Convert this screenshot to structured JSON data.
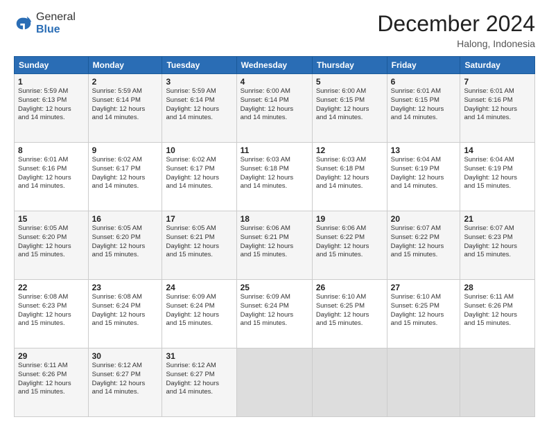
{
  "header": {
    "logo_general": "General",
    "logo_blue": "Blue",
    "month_title": "December 2024",
    "location": "Halong, Indonesia"
  },
  "weekdays": [
    "Sunday",
    "Monday",
    "Tuesday",
    "Wednesday",
    "Thursday",
    "Friday",
    "Saturday"
  ],
  "weeks": [
    [
      {
        "day": "1",
        "sunrise": "5:59 AM",
        "sunset": "6:13 PM",
        "daylight": "12 hours and 14 minutes."
      },
      {
        "day": "2",
        "sunrise": "5:59 AM",
        "sunset": "6:14 PM",
        "daylight": "12 hours and 14 minutes."
      },
      {
        "day": "3",
        "sunrise": "5:59 AM",
        "sunset": "6:14 PM",
        "daylight": "12 hours and 14 minutes."
      },
      {
        "day": "4",
        "sunrise": "6:00 AM",
        "sunset": "6:14 PM",
        "daylight": "12 hours and 14 minutes."
      },
      {
        "day": "5",
        "sunrise": "6:00 AM",
        "sunset": "6:15 PM",
        "daylight": "12 hours and 14 minutes."
      },
      {
        "day": "6",
        "sunrise": "6:01 AM",
        "sunset": "6:15 PM",
        "daylight": "12 hours and 14 minutes."
      },
      {
        "day": "7",
        "sunrise": "6:01 AM",
        "sunset": "6:16 PM",
        "daylight": "12 hours and 14 minutes."
      }
    ],
    [
      {
        "day": "8",
        "sunrise": "6:01 AM",
        "sunset": "6:16 PM",
        "daylight": "12 hours and 14 minutes."
      },
      {
        "day": "9",
        "sunrise": "6:02 AM",
        "sunset": "6:17 PM",
        "daylight": "12 hours and 14 minutes."
      },
      {
        "day": "10",
        "sunrise": "6:02 AM",
        "sunset": "6:17 PM",
        "daylight": "12 hours and 14 minutes."
      },
      {
        "day": "11",
        "sunrise": "6:03 AM",
        "sunset": "6:18 PM",
        "daylight": "12 hours and 14 minutes."
      },
      {
        "day": "12",
        "sunrise": "6:03 AM",
        "sunset": "6:18 PM",
        "daylight": "12 hours and 14 minutes."
      },
      {
        "day": "13",
        "sunrise": "6:04 AM",
        "sunset": "6:19 PM",
        "daylight": "12 hours and 14 minutes."
      },
      {
        "day": "14",
        "sunrise": "6:04 AM",
        "sunset": "6:19 PM",
        "daylight": "12 hours and 15 minutes."
      }
    ],
    [
      {
        "day": "15",
        "sunrise": "6:05 AM",
        "sunset": "6:20 PM",
        "daylight": "12 hours and 15 minutes."
      },
      {
        "day": "16",
        "sunrise": "6:05 AM",
        "sunset": "6:20 PM",
        "daylight": "12 hours and 15 minutes."
      },
      {
        "day": "17",
        "sunrise": "6:05 AM",
        "sunset": "6:21 PM",
        "daylight": "12 hours and 15 minutes."
      },
      {
        "day": "18",
        "sunrise": "6:06 AM",
        "sunset": "6:21 PM",
        "daylight": "12 hours and 15 minutes."
      },
      {
        "day": "19",
        "sunrise": "6:06 AM",
        "sunset": "6:22 PM",
        "daylight": "12 hours and 15 minutes."
      },
      {
        "day": "20",
        "sunrise": "6:07 AM",
        "sunset": "6:22 PM",
        "daylight": "12 hours and 15 minutes."
      },
      {
        "day": "21",
        "sunrise": "6:07 AM",
        "sunset": "6:23 PM",
        "daylight": "12 hours and 15 minutes."
      }
    ],
    [
      {
        "day": "22",
        "sunrise": "6:08 AM",
        "sunset": "6:23 PM",
        "daylight": "12 hours and 15 minutes."
      },
      {
        "day": "23",
        "sunrise": "6:08 AM",
        "sunset": "6:24 PM",
        "daylight": "12 hours and 15 minutes."
      },
      {
        "day": "24",
        "sunrise": "6:09 AM",
        "sunset": "6:24 PM",
        "daylight": "12 hours and 15 minutes."
      },
      {
        "day": "25",
        "sunrise": "6:09 AM",
        "sunset": "6:24 PM",
        "daylight": "12 hours and 15 minutes."
      },
      {
        "day": "26",
        "sunrise": "6:10 AM",
        "sunset": "6:25 PM",
        "daylight": "12 hours and 15 minutes."
      },
      {
        "day": "27",
        "sunrise": "6:10 AM",
        "sunset": "6:25 PM",
        "daylight": "12 hours and 15 minutes."
      },
      {
        "day": "28",
        "sunrise": "6:11 AM",
        "sunset": "6:26 PM",
        "daylight": "12 hours and 15 minutes."
      }
    ],
    [
      {
        "day": "29",
        "sunrise": "6:11 AM",
        "sunset": "6:26 PM",
        "daylight": "12 hours and 15 minutes."
      },
      {
        "day": "30",
        "sunrise": "6:12 AM",
        "sunset": "6:27 PM",
        "daylight": "12 hours and 14 minutes."
      },
      {
        "day": "31",
        "sunrise": "6:12 AM",
        "sunset": "6:27 PM",
        "daylight": "12 hours and 14 minutes."
      },
      null,
      null,
      null,
      null
    ]
  ],
  "labels": {
    "sunrise": "Sunrise:",
    "sunset": "Sunset:",
    "daylight": "Daylight:"
  }
}
